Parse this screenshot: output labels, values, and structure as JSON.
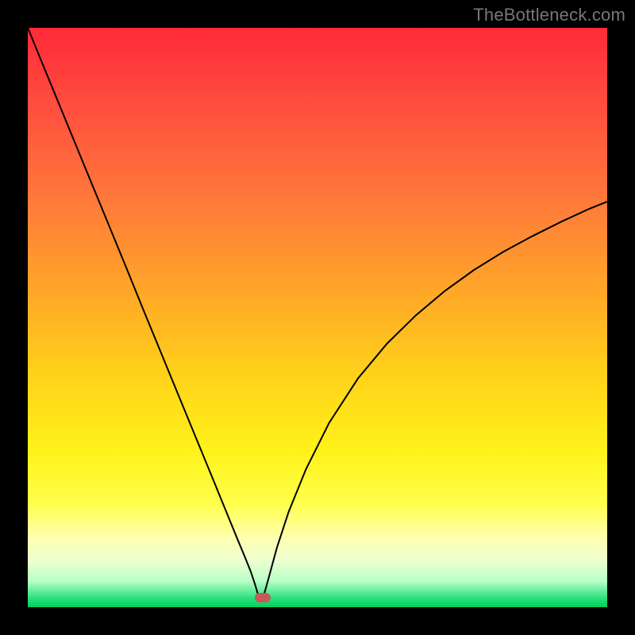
{
  "watermark": "TheBottleneck.com",
  "chart_data": {
    "type": "line",
    "title": "",
    "xlabel": "",
    "ylabel": "",
    "xlim": [
      0,
      100
    ],
    "ylim": [
      0,
      100
    ],
    "gradient_stops": [
      {
        "offset": 0.0,
        "color": "#ff2a3a"
      },
      {
        "offset": 0.14,
        "color": "#ff4f3e"
      },
      {
        "offset": 0.3,
        "color": "#ff7a3a"
      },
      {
        "offset": 0.45,
        "color": "#ffa528"
      },
      {
        "offset": 0.6,
        "color": "#ffd21a"
      },
      {
        "offset": 0.73,
        "color": "#fff21a"
      },
      {
        "offset": 0.82,
        "color": "#ffff4a"
      },
      {
        "offset": 0.88,
        "color": "#ffffb0"
      },
      {
        "offset": 0.92,
        "color": "#ecffd0"
      },
      {
        "offset": 0.955,
        "color": "#b8ffc8"
      },
      {
        "offset": 0.985,
        "color": "#28e07a"
      },
      {
        "offset": 1.0,
        "color": "#00d060"
      }
    ],
    "series": [
      {
        "name": "bottleneck-curve",
        "x": [
          0,
          2,
          5,
          8,
          11,
          14,
          17,
          20,
          23,
          26,
          29,
          32,
          34,
          36,
          37.5,
          38.5,
          39.2,
          39.7,
          40,
          40.3,
          40.8,
          41.5,
          43,
          45,
          48,
          52,
          57,
          62,
          67,
          72,
          77,
          82,
          87,
          92,
          97,
          100
        ],
        "y": [
          100,
          95.1,
          87.8,
          80.5,
          73.2,
          65.9,
          58.6,
          51.2,
          43.9,
          36.6,
          29.3,
          22.0,
          17.1,
          12.2,
          8.6,
          6.1,
          4.0,
          2.3,
          1.0,
          1.0,
          2.3,
          4.8,
          10.3,
          16.4,
          23.8,
          31.8,
          39.5,
          45.5,
          50.4,
          54.6,
          58.2,
          61.3,
          64.0,
          66.5,
          68.8,
          70.0
        ]
      }
    ],
    "marker": {
      "x": 40.5,
      "y": 1.7,
      "color": "#c65a56"
    }
  }
}
